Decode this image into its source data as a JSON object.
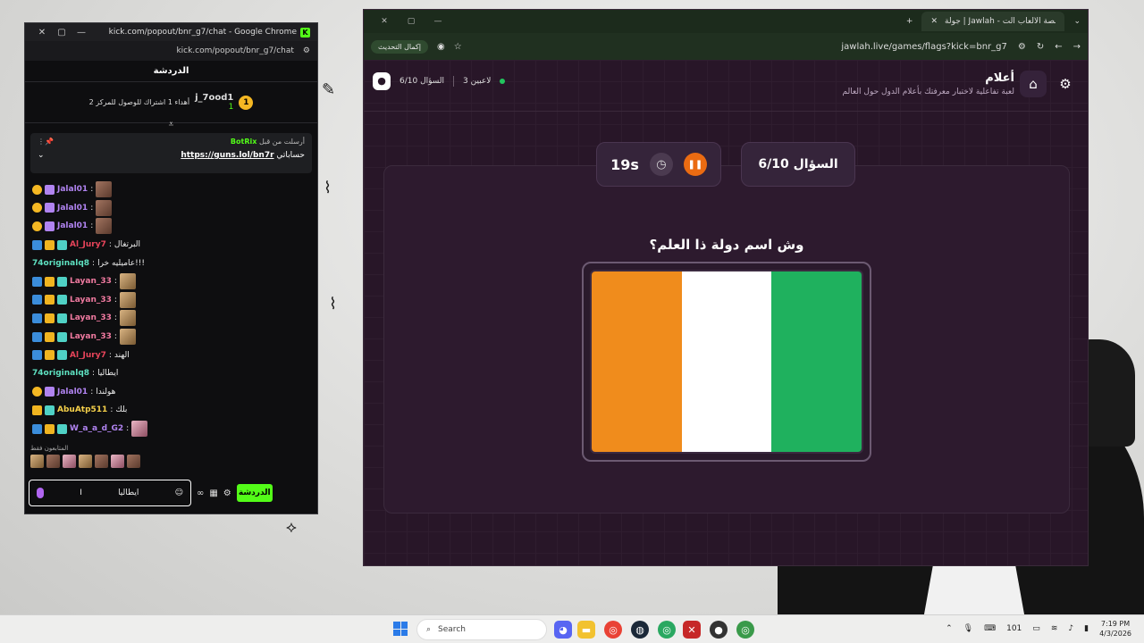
{
  "chat": {
    "window_title": "kick.com/popout/bnr_g7/chat - Google Chrome",
    "url": "kick.com/popout/bnr_g7/chat",
    "header": "الدردشة",
    "leaderboard": {
      "rank": "1",
      "user": "j_7ood1",
      "count": "1",
      "label": "أهداء 1 اشتراك للوصول للمركز 2"
    },
    "pinned": {
      "label": "أرسلت من قبل",
      "sender": "BotRix",
      "text_prefix": "حساباتي",
      "link": "https://guns.lol/bn7r"
    },
    "messages": [
      {
        "user": "Jalal01",
        "color": "#b083f0",
        "text": "",
        "badges": [
          "gold",
          "purple"
        ],
        "emote": "brown"
      },
      {
        "user": "Jalal01",
        "color": "#b083f0",
        "text": "",
        "badges": [
          "gold",
          "purple"
        ],
        "emote": "brown"
      },
      {
        "user": "Jalal01",
        "color": "#b083f0",
        "text": "",
        "badges": [
          "gold",
          "purple"
        ],
        "emote": "brown"
      },
      {
        "user": "Al_Jury7",
        "color": "#e8445a",
        "text": "البرتغال",
        "badges": [
          "blue",
          "crown",
          "green"
        ],
        "emote": ""
      },
      {
        "user": "74originalq8",
        "color": "#5ee0c0",
        "text": "عاميليه خرا!!!",
        "badges": [],
        "emote": ""
      },
      {
        "user": "Layan_33",
        "color": "#f07aa0",
        "text": "",
        "badges": [
          "blue",
          "crown",
          "green"
        ],
        "emote": "tan"
      },
      {
        "user": "Layan_33",
        "color": "#f07aa0",
        "text": "",
        "badges": [
          "blue",
          "crown",
          "green"
        ],
        "emote": "tan"
      },
      {
        "user": "Layan_33",
        "color": "#f07aa0",
        "text": "",
        "badges": [
          "blue",
          "crown",
          "green"
        ],
        "emote": "tan"
      },
      {
        "user": "Layan_33",
        "color": "#f07aa0",
        "text": "",
        "badges": [
          "blue",
          "crown",
          "green"
        ],
        "emote": "tan"
      },
      {
        "user": "Al_Jury7",
        "color": "#e8445a",
        "text": "الهند",
        "badges": [
          "blue",
          "crown",
          "green"
        ],
        "emote": ""
      },
      {
        "user": "74originalq8",
        "color": "#5ee0c0",
        "text": "ايطاليا",
        "badges": [],
        "emote": ""
      },
      {
        "user": "Jalal01",
        "color": "#b083f0",
        "text": "هولندا",
        "badges": [
          "gold",
          "purple"
        ],
        "emote": ""
      },
      {
        "user": "AbuAtp511",
        "color": "#f5d04a",
        "text": "بلك",
        "badges": [
          "crown",
          "green"
        ],
        "emote": ""
      },
      {
        "user": "W_a_a_d_G2",
        "color": "#b083f0",
        "text": "",
        "badges": [
          "blue",
          "crown",
          "green"
        ],
        "emote": "pink"
      }
    ],
    "subs_label": "المتابعون فقط",
    "input_value": "ايطاليا",
    "send_label": "الدردشة"
  },
  "browser": {
    "tab_title": "جولة | Jawlah - منصة الألعاب الت",
    "url": "jawlah.live/games/flags?kick=bnr_g7",
    "update_label": "إكمال التحديث"
  },
  "game": {
    "title": "أعلام",
    "subtitle": "لعبة تفاعلية لاختبار معرفتك بأعلام الدول حول العالم",
    "players": "3 لاعبين",
    "progress_short": "السؤال 6/10",
    "timer": "19s",
    "question_number": "السؤال 6/10",
    "question": "وش اسم دولة ذا العلم؟",
    "flag_colors": [
      "#f08c1c",
      "#ffffff",
      "#1fb15e"
    ]
  },
  "taskbar": {
    "search_placeholder": "Search",
    "time": "7:19 PM",
    "date": "4/3/2026",
    "badge_count": "101"
  }
}
